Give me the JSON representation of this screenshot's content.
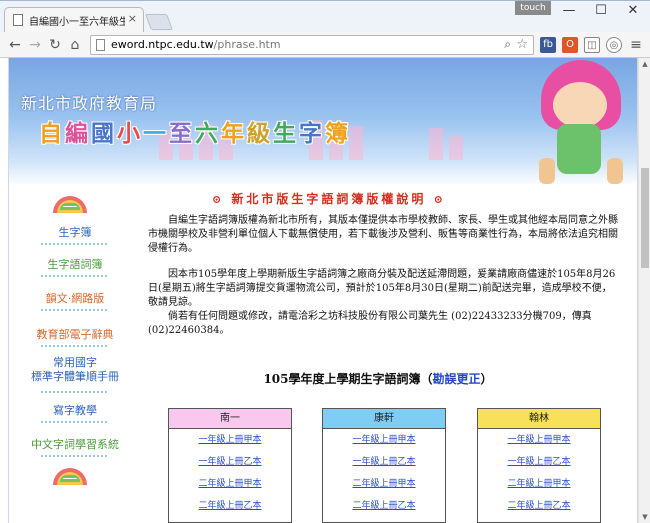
{
  "browser": {
    "tab_title": "自編國小一至六年級生字簿",
    "tab_close": "×",
    "touch_label": "touch",
    "window_buttons": [
      "—",
      "☐",
      "✕"
    ],
    "url_host": "eword.ntpc.edu.tw",
    "url_path": "/phrase.htm",
    "ext_labels": [
      "fb",
      "O"
    ]
  },
  "banner": {
    "gov_title": "新北市政府教育局",
    "big_title_chars": [
      "自",
      "編",
      "國",
      "小",
      "一",
      "至",
      "六",
      "年",
      "級",
      "生",
      "字",
      "簿"
    ]
  },
  "sidebar": {
    "items": [
      {
        "label": "生字簿"
      },
      {
        "label": "生字語詞簿"
      },
      {
        "label": "韻文·網路版"
      },
      {
        "label": "教育部電子辭典"
      },
      {
        "label": "常用國字",
        "label2": "標準字體筆順手冊"
      },
      {
        "label": "寫字教學"
      },
      {
        "label": "中文字詞學習系統"
      }
    ]
  },
  "content": {
    "notice_title": "新北市版生字語詞簿版權說明",
    "notice_marker": "⊙",
    "para1": "自編生字語詞簿版權為新北市所有，其版本僅提供本市學校教師、家長、學生或其他經本局同意之外縣市機關學校及非營利單位個人下載無償使用，若下載後涉及營利、販售等商業性行為，本局將依法追究相關侵權行為。",
    "para2": "因本市105學年度上學期新版生字語詞簿之廠商分裝及配送延滯問題，爰業請廠商儘速於105年8月26日(星期五)將生字語詞簿提交貨運物流公司，預計於105年8月30日(星期二)前配送完畢，造成學校不便，敬請見諒。",
    "para3": "倘若有任何問題或修改，請電洽彩之坊科技股份有限公司葉先生 (02)22433233分機709，傳真 (02)22460384。",
    "heading": "105學年度上學期生字語詞簿",
    "heading_link": "勘誤更正",
    "publishers": [
      {
        "name": "南一",
        "color": "#f9c8ef",
        "links": [
          "一年級上冊甲本",
          "一年級上冊乙本",
          "二年級上冊甲本",
          "二年級上冊乙本"
        ]
      },
      {
        "name": "康軒",
        "color": "#7fcdf4",
        "links": [
          "一年級上冊甲本",
          "一年級上冊乙本",
          "二年級上冊甲本",
          "二年級上冊乙本"
        ]
      },
      {
        "name": "翰林",
        "color": "#f7e05a",
        "links": [
          "一年級上冊甲本",
          "一年級上冊乙本",
          "二年級上冊甲本",
          "二年級上冊乙本"
        ]
      }
    ]
  }
}
